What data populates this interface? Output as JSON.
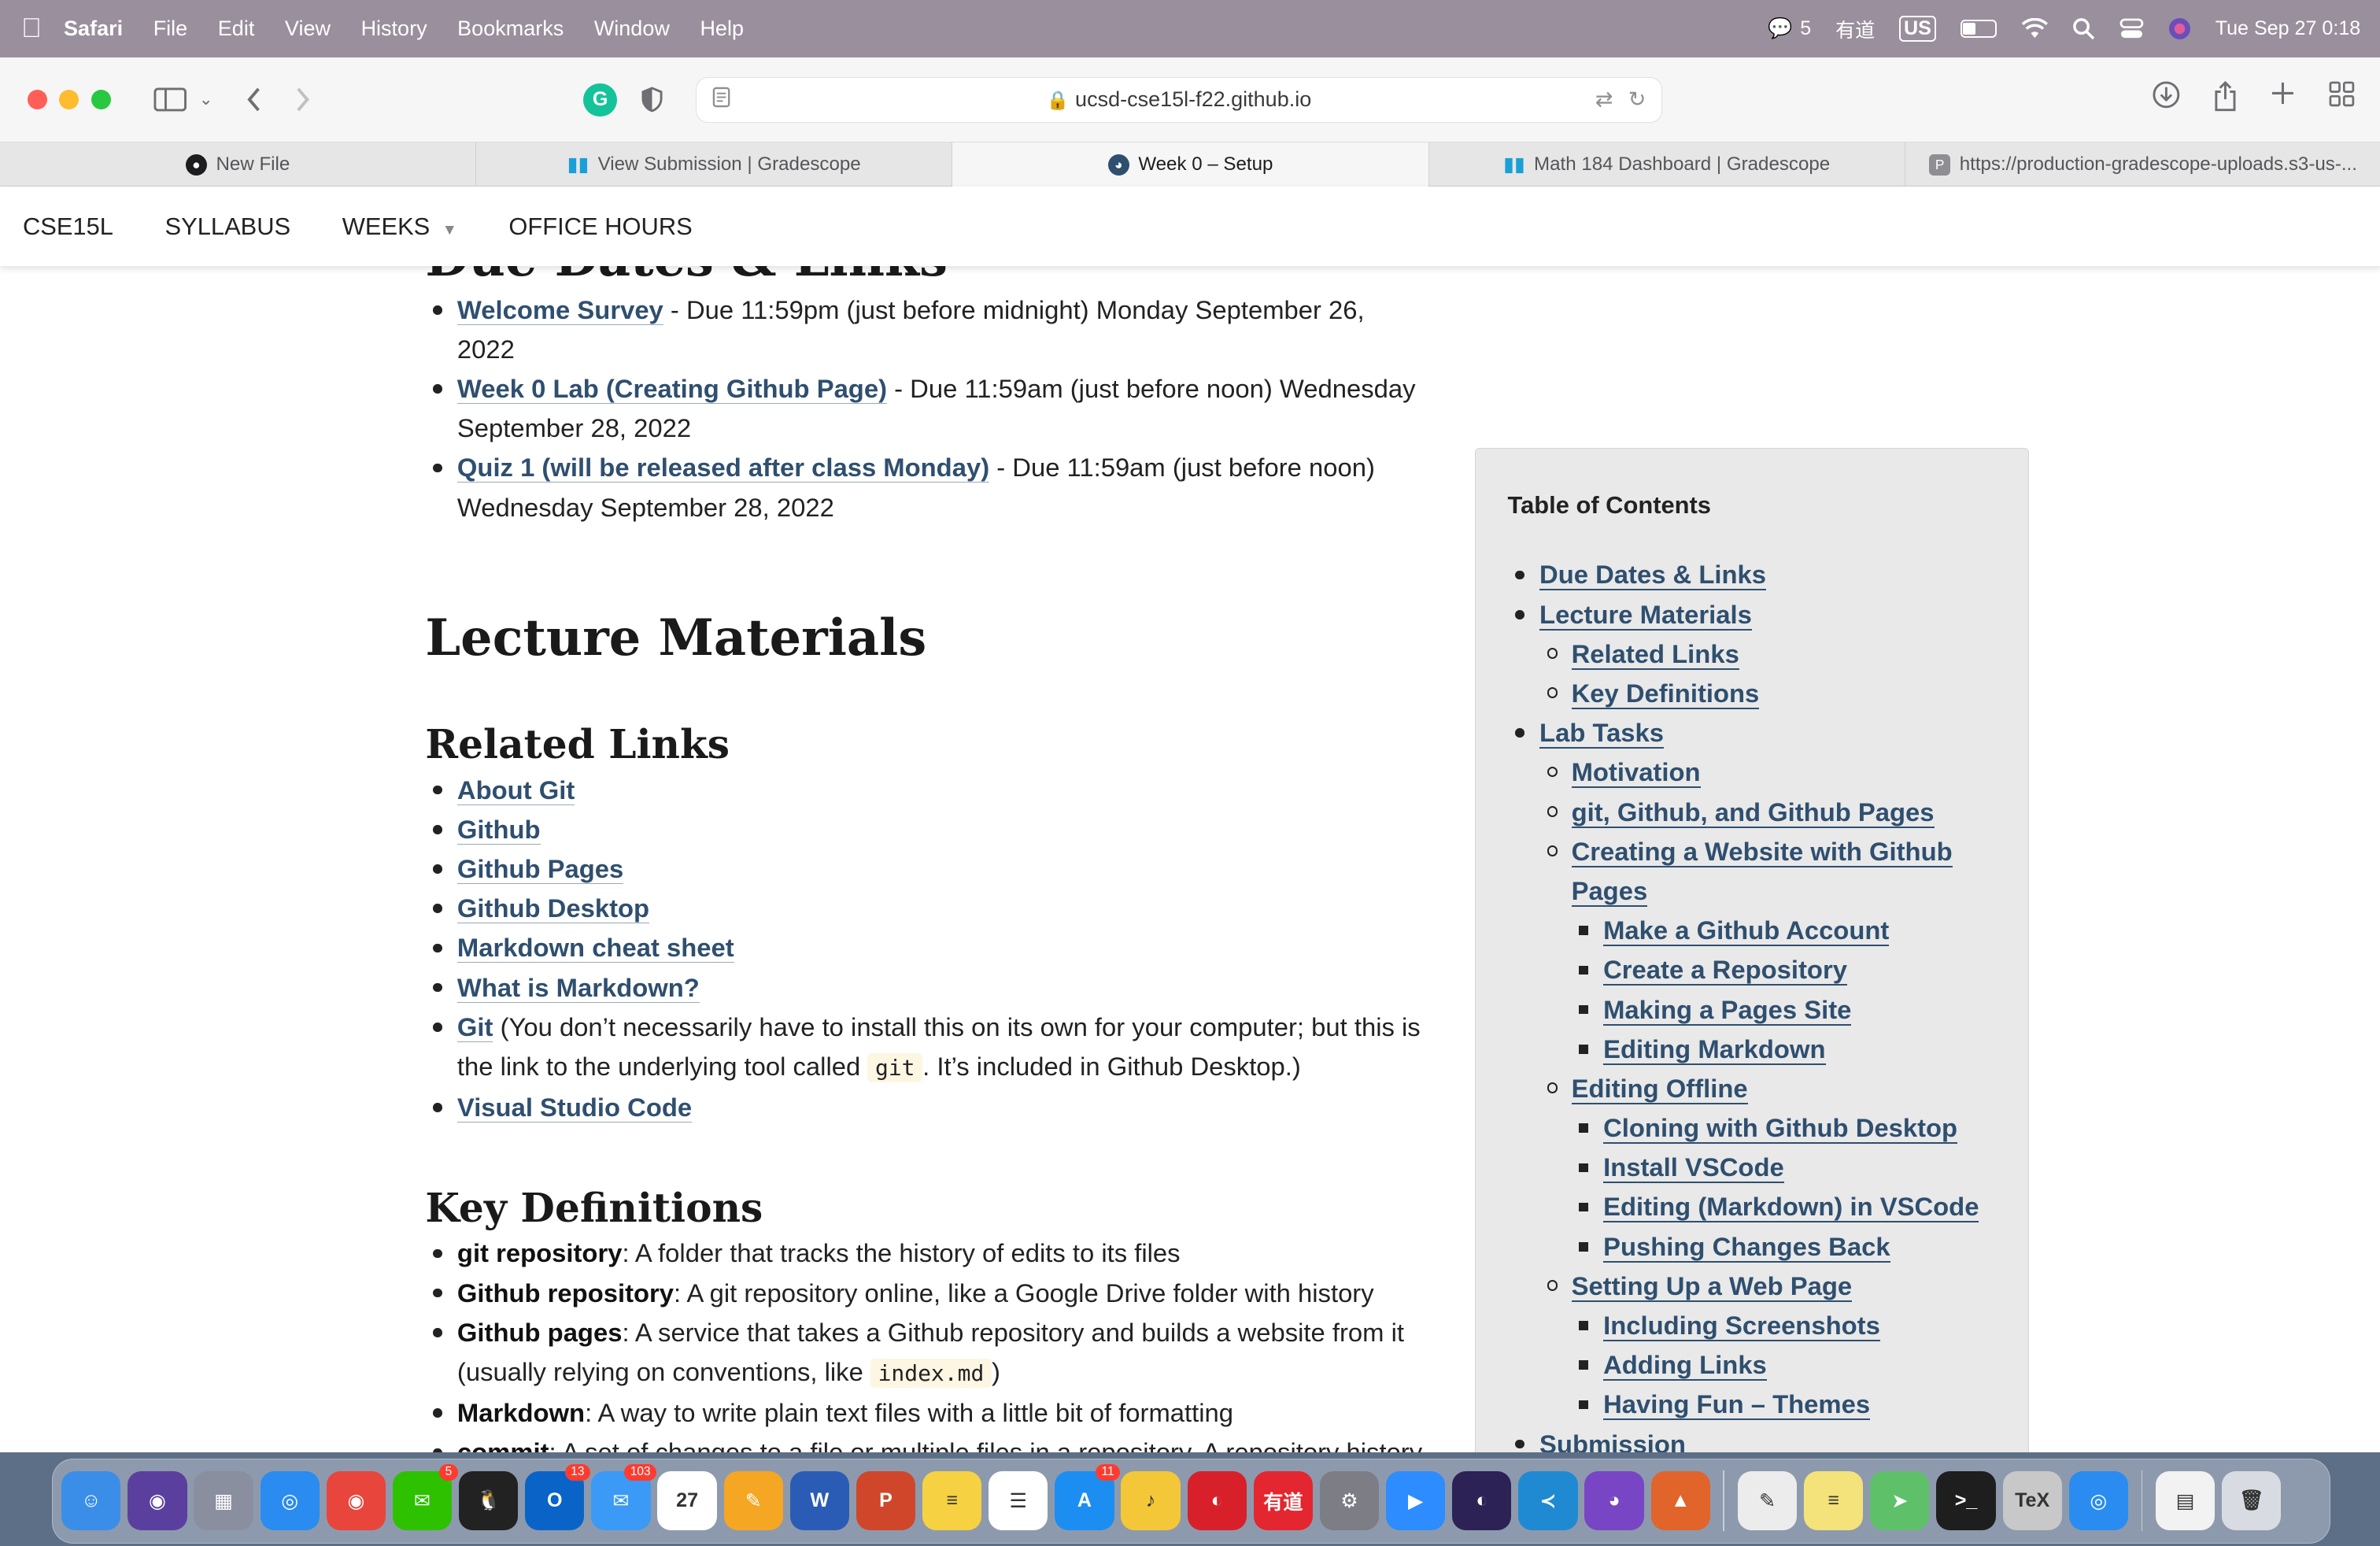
{
  "menubar": {
    "app_name": "Safari",
    "items": [
      "File",
      "Edit",
      "View",
      "History",
      "Bookmarks",
      "Window",
      "Help"
    ],
    "wechat_count": "5",
    "youdao": "有道",
    "input_source": "US",
    "datetime": "Tue Sep 27  0:18"
  },
  "browser": {
    "url": "ucsd-cse15l-f22.github.io",
    "tabs": [
      {
        "title": "New File",
        "icon": "github-icon",
        "color": "#1d1d1f",
        "active": false
      },
      {
        "title": "View Submission | Gradescope",
        "icon": "gradescope-icon",
        "color": "#1a9fd6",
        "active": false
      },
      {
        "title": "Week 0 – Setup",
        "icon": "site-icon",
        "color": "#2f4f6f",
        "active": true
      },
      {
        "title": "Math 184 Dashboard | Gradescope",
        "icon": "gradescope-icon",
        "color": "#1a9fd6",
        "active": false
      },
      {
        "title": "https://production-gradescope-uploads.s3-us-...",
        "icon": "p-icon",
        "color": "#8e8e93",
        "active": false
      }
    ]
  },
  "sitenav": {
    "home": "CSE15L",
    "syllabus": "SYLLABUS",
    "weeks": "WEEKS",
    "office_hours": "OFFICE HOURS"
  },
  "content": {
    "due_heading": "Due Dates & Links",
    "due_items": [
      {
        "link": "Welcome Survey",
        "text": " - Due 11:59pm (just before midnight) Monday September 26, 2022"
      },
      {
        "link": "Week 0 Lab (Creating Github Page)",
        "text": " - Due 11:59am (just before noon) Wednesday September 28, 2022"
      },
      {
        "link": "Quiz 1 (will be released after class Monday)",
        "text": " - Due 11:59am (just before noon) Wednesday September 28, 2022"
      }
    ],
    "lecture_heading": "Lecture Materials",
    "related_heading": "Related Links",
    "related_links": [
      "About Git",
      "Github",
      "Github Pages",
      "Github Desktop",
      "Markdown cheat sheet",
      "What is Markdown?"
    ],
    "git_item": {
      "link": "Git",
      "text_before": " (You don’t necessarily have to install this on its own for your computer; but this is the link to the underlying tool called ",
      "code": "git",
      "text_after": ". It’s included in Github Desktop.)"
    },
    "vscode_link": "Visual Studio Code",
    "key_heading": "Key Definitions",
    "definitions": [
      {
        "term": "git repository",
        "text": ": A folder that tracks the history of edits to its files"
      },
      {
        "term": "Github repository",
        "text": ": A git repository online, like a Google Drive folder with history"
      },
      {
        "term": "Github pages",
        "text": ": A service that takes a Github repository and builds a website from it (usually relying on conventions, like ",
        "code": "index.md",
        "text_after": ")"
      },
      {
        "term": "Markdown",
        "text": ": A way to write plain text files with a little bit of formatting"
      },
      {
        "term": "commit",
        "text": ": A set of changes to a file or multiple files in a repository. A repository history is made up of commits"
      }
    ]
  },
  "toc": {
    "title": "Table of Contents",
    "items": [
      {
        "label": "Due Dates & Links",
        "level": 1
      },
      {
        "label": "Lecture Materials",
        "level": 1
      },
      {
        "label": "Related Links",
        "level": 2
      },
      {
        "label": "Key Definitions",
        "level": 2
      },
      {
        "label": "Lab Tasks",
        "level": 1
      },
      {
        "label": "Motivation",
        "level": 2
      },
      {
        "label": "git, Github, and Github Pages",
        "level": 2
      },
      {
        "label": "Creating a Website with Github Pages",
        "level": 2
      },
      {
        "label": "Make a Github Account",
        "level": 3
      },
      {
        "label": "Create a Repository",
        "level": 3
      },
      {
        "label": "Making a Pages Site",
        "level": 3
      },
      {
        "label": "Editing Markdown",
        "level": 3
      },
      {
        "label": "Editing Offline",
        "level": 2
      },
      {
        "label": "Cloning with Github Desktop",
        "level": 3
      },
      {
        "label": "Install VSCode",
        "level": 3
      },
      {
        "label": "Editing (Markdown) in VSCode",
        "level": 3
      },
      {
        "label": "Pushing Changes Back",
        "level": 3
      },
      {
        "label": "Setting Up a Web Page",
        "level": 2
      },
      {
        "label": "Including Screenshots",
        "level": 3
      },
      {
        "label": "Adding Links",
        "level": 3
      },
      {
        "label": "Having Fun – Themes",
        "level": 3
      },
      {
        "label": "Submission",
        "level": 1
      }
    ]
  },
  "dock": {
    "apps": [
      {
        "name": "finder-icon",
        "color": "#3b8ee8",
        "label": "☺",
        "badge": ""
      },
      {
        "name": "siri-icon",
        "color": "#5b3f9e",
        "label": "◉",
        "badge": ""
      },
      {
        "name": "launchpad-icon",
        "color": "#8a8fa0",
        "label": "▦",
        "badge": ""
      },
      {
        "name": "safari-icon",
        "color": "#2a8cf0",
        "label": "◎",
        "badge": ""
      },
      {
        "name": "chrome-icon",
        "color": "#e8453c",
        "label": "◉",
        "badge": ""
      },
      {
        "name": "wechat-icon",
        "color": "#2dc100",
        "label": "✉",
        "badge": "5"
      },
      {
        "name": "qq-icon",
        "color": "#222222",
        "label": "🐧",
        "badge": ""
      },
      {
        "name": "outlook-icon",
        "color": "#0a64c8",
        "label": "O",
        "badge": "13"
      },
      {
        "name": "mail-icon",
        "color": "#3a9af5",
        "label": "✉",
        "badge": "103"
      },
      {
        "name": "calendar-icon",
        "color": "#ffffff",
        "label": "27",
        "badge": ""
      },
      {
        "name": "pages-icon",
        "color": "#f5a623",
        "label": "✎",
        "badge": ""
      },
      {
        "name": "word-icon",
        "color": "#2b5cb5",
        "label": "W",
        "badge": ""
      },
      {
        "name": "powerpoint-icon",
        "color": "#d0462a",
        "label": "P",
        "badge": ""
      },
      {
        "name": "notes-icon",
        "color": "#f6d243",
        "label": "≡",
        "badge": ""
      },
      {
        "name": "reminders-icon",
        "color": "#ffffff",
        "label": "☰",
        "badge": ""
      },
      {
        "name": "appstore-icon",
        "color": "#1c8ef2",
        "label": "A",
        "badge": "11"
      },
      {
        "name": "music-icon",
        "color": "#f3c737",
        "label": "♪",
        "badge": ""
      },
      {
        "name": "netease-music-icon",
        "color": "#d8202a",
        "label": "◐",
        "badge": ""
      },
      {
        "name": "youdao-icon",
        "color": "#e3262f",
        "label": "有道",
        "badge": ""
      },
      {
        "name": "system-settings-icon",
        "color": "#7d7d85",
        "label": "⚙",
        "badge": ""
      },
      {
        "name": "zoom-icon",
        "color": "#2d8cff",
        "label": "▶",
        "badge": ""
      },
      {
        "name": "eclipse-icon",
        "color": "#2c2255",
        "label": "◐",
        "badge": ""
      },
      {
        "name": "vscode-icon",
        "color": "#1f8ad2",
        "label": "≺",
        "badge": ""
      },
      {
        "name": "github-desktop-icon",
        "color": "#7845c4",
        "label": "◕",
        "badge": ""
      },
      {
        "name": "matlab-icon",
        "color": "#e1642a",
        "label": "▲",
        "badge": ""
      },
      {
        "name": "textedit-icon",
        "color": "#ececec",
        "label": "✎",
        "badge": ""
      },
      {
        "name": "stickies-icon",
        "color": "#f4e27a",
        "label": "≡",
        "badge": ""
      },
      {
        "name": "maps-icon",
        "color": "#5ec16a",
        "label": "➤",
        "badge": ""
      },
      {
        "name": "terminal-icon",
        "color": "#1e1e1e",
        "label": ">_",
        "badge": ""
      },
      {
        "name": "latexit-icon",
        "color": "#c8c8c8",
        "label": "TeX",
        "badge": ""
      },
      {
        "name": "safari-icon",
        "color": "#2a8cf0",
        "label": "◎",
        "badge": ""
      },
      {
        "name": "downloads-stack-icon",
        "color": "#f2f2f2",
        "label": "▤",
        "badge": ""
      },
      {
        "name": "trash-icon",
        "color": "#d8dce2",
        "label": "🗑",
        "badge": ""
      }
    ]
  }
}
